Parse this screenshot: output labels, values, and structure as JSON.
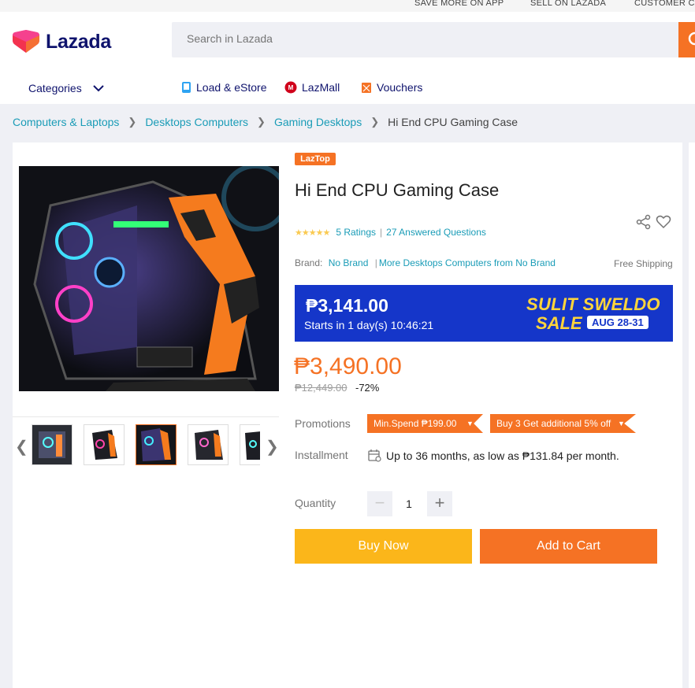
{
  "topbar": {
    "save_more": "SAVE MORE ON APP",
    "sell": "SELL ON LAZADA",
    "customer_care": "CUSTOMER CA"
  },
  "header": {
    "logo_text": "Lazada",
    "search_placeholder": "Search in Lazada",
    "categories_label": "Categories",
    "nav": [
      {
        "label": "Load & eStore",
        "icon": "phone-icon"
      },
      {
        "label": "LazMall",
        "icon": "lazmall-icon"
      },
      {
        "label": "Vouchers",
        "icon": "voucher-icon"
      }
    ]
  },
  "breadcrumb": [
    "Computers & Laptops",
    "Desktops Computers",
    "Gaming Desktops",
    "Hi End CPU Gaming Case"
  ],
  "product": {
    "badge": "LazTop",
    "title": "Hi End CPU Gaming Case",
    "stars": "★★★★★",
    "ratings": "5 Ratings",
    "questions": "27 Answered Questions",
    "brand_label": "Brand:",
    "brand": "No Brand",
    "more_from": "More Desktops Computers from No Brand",
    "free_shipping": "Free Shipping",
    "flash": {
      "price": "₱3,141.00",
      "starts": "Starts in 1 day(s) 10:46:21",
      "sale_line1": "SULIT SWELDO",
      "sale_line2": "SALE",
      "sale_dates": "AUG 28-31"
    },
    "price": "₱3,490.00",
    "original_price": "₱12,449.00",
    "discount": "-72%",
    "promotions_label": "Promotions",
    "promos": [
      "Min.Spend ₱199.00",
      "Buy 3 Get additional 5% off"
    ],
    "installment_label": "Installment",
    "installment_text": "Up to 36 months, as low as ₱131.84 per month.",
    "quantity_label": "Quantity",
    "quantity": "1",
    "buy_now": "Buy Now",
    "add_to_cart": "Add to Cart"
  },
  "colors": {
    "accent": "#f57224",
    "link": "#1a9cb7",
    "brand_navy": "#0f136d",
    "flash_blue": "#1536c9",
    "buy_now": "#fbb61a"
  }
}
